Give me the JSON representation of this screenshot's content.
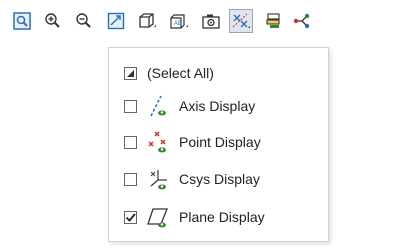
{
  "toolbar": {
    "buttons": [
      {
        "name": "fit-icon"
      },
      {
        "name": "zoom-in-icon"
      },
      {
        "name": "zoom-out-icon"
      },
      {
        "name": "rotate-view-icon"
      },
      {
        "name": "view-cube-icon"
      },
      {
        "name": "render-style-icon"
      },
      {
        "name": "camera-icon"
      },
      {
        "name": "datum-display-icon",
        "active": true
      },
      {
        "name": "layer-icon"
      },
      {
        "name": "branch-icon"
      }
    ]
  },
  "menu": {
    "items": [
      {
        "label": "(Select All)",
        "checked": "partial"
      },
      {
        "label": "Axis Display",
        "checked": false
      },
      {
        "label": "Point Display",
        "checked": false
      },
      {
        "label": "Csys Display",
        "checked": false
      },
      {
        "label": "Plane Display",
        "checked": true
      }
    ]
  },
  "colors": {
    "toolbar_blue": "#2a6fb6",
    "icon_green": "#2f8a2f",
    "menu_border": "#cfd3d8",
    "active_bg": "#dfe6ef"
  }
}
